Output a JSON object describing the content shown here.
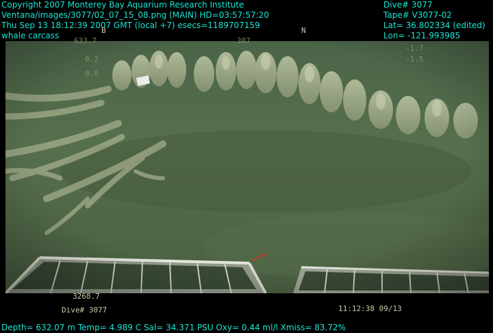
{
  "header": {
    "copyright": "Copyright 2007 Monterey Bay Aquarium Research Institute",
    "image_path": "Ventana/images/3077/02_07_15_08.png (MAIN)  HD=03:57:57:20",
    "datetime": "Thu Sep 13 18:12:39 2007 GMT (local +7)  esecs=1189707159",
    "subject": "whale carcass",
    "dive": "Dive# 3077",
    "tape": "Tape# V3077-02",
    "lat": "Lat= 36.802334 (edited)",
    "lon": "Lon= -121.993985"
  },
  "hud": {
    "compass_n": "N",
    "compass_b": "B",
    "heading_left": "633.7",
    "heading_right": "307",
    "pitch": "0.2",
    "roll": "0.0",
    "right_value": "-1.5",
    "right_value_top": "-1.7",
    "depth_small": "3268.7",
    "dive_small": "Dive# 3077",
    "clock": "11:12:38 09/13"
  },
  "footer": {
    "sensors": "Depth= 632.07 m  Temp= 4.989 C  Sal= 34.371 PSU  Oxy= 0.44 ml/l  Xmiss= 83.72%"
  },
  "colors": {
    "overlay_text": "#19e6d4",
    "water": "#4f6a4a",
    "bone": "#b8bfa0"
  }
}
